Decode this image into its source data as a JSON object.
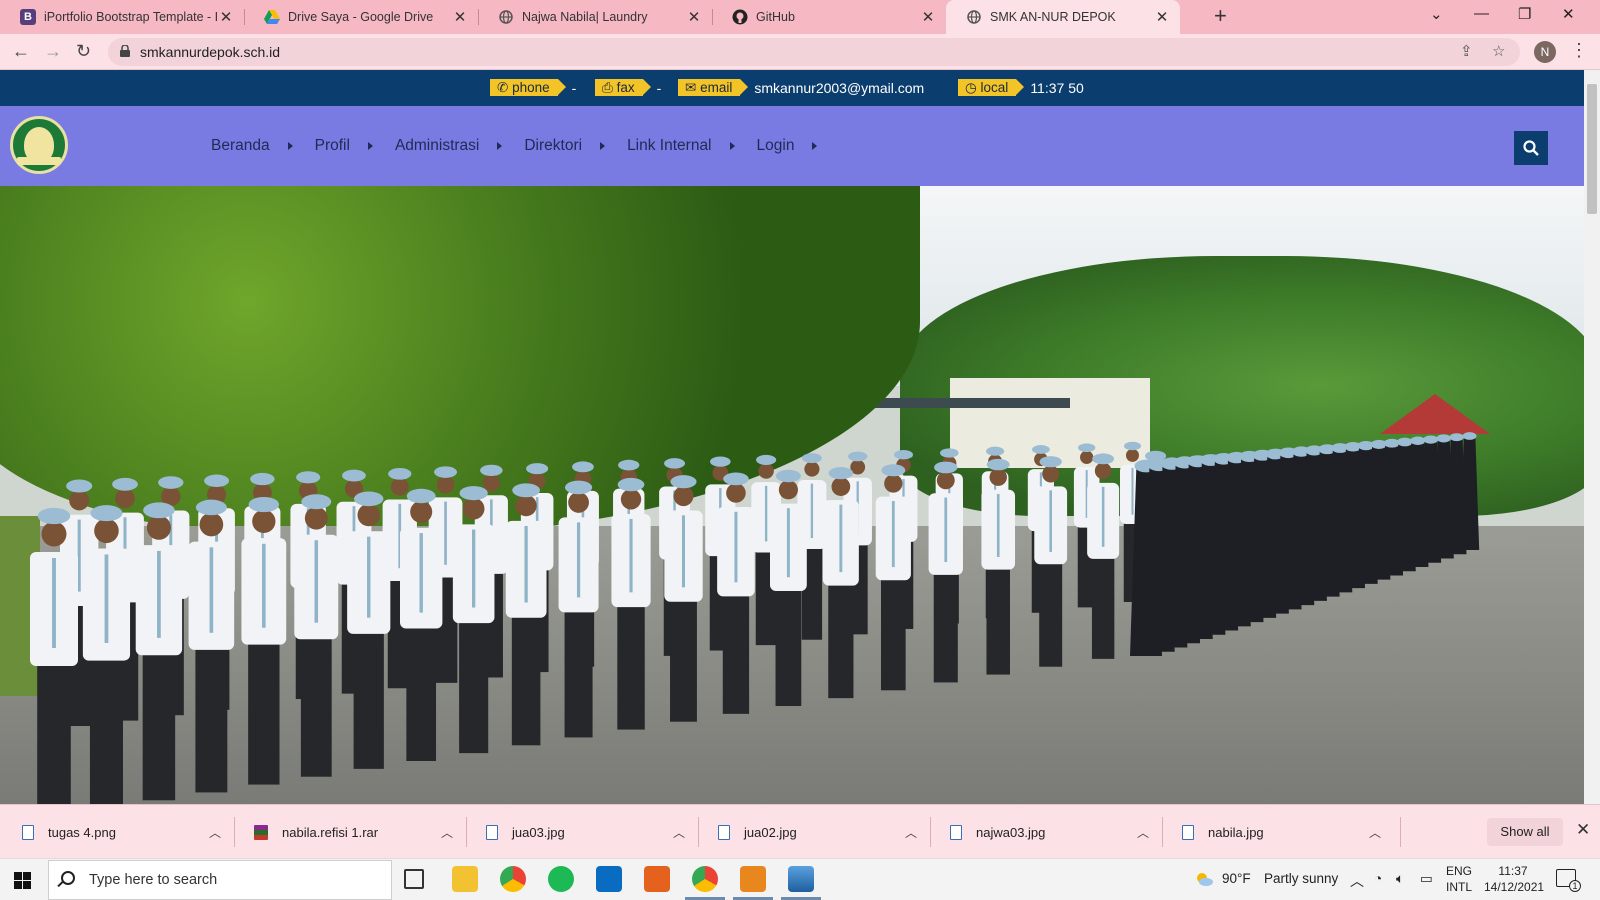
{
  "browser": {
    "tabs": [
      {
        "title": "iPortfolio Bootstrap Template - In",
        "favicon": "bootstrap-icon",
        "active": false
      },
      {
        "title": "Drive Saya - Google Drive",
        "favicon": "google-drive-icon",
        "active": false
      },
      {
        "title": "Najwa Nabila| Laundry",
        "favicon": "globe-icon",
        "active": false
      },
      {
        "title": "GitHub",
        "favicon": "github-icon",
        "active": false
      },
      {
        "title": "SMK AN-NUR DEPOK",
        "favicon": "globe-icon",
        "active": true
      }
    ],
    "url": "smkannurdepok.sch.id",
    "profile_initial": "N"
  },
  "site": {
    "topbar": {
      "items": [
        {
          "tag": "phone",
          "icon": "phone-icon",
          "value": "-"
        },
        {
          "tag": "fax",
          "icon": "fax-icon",
          "value": "-"
        },
        {
          "tag": "email",
          "icon": "envelope-icon",
          "value": "smkannur2003@ymail.com"
        },
        {
          "tag": "local",
          "icon": "clock-icon",
          "value": "11:37 50"
        }
      ]
    },
    "menu": [
      "Beranda",
      "Profil",
      "Administrasi",
      "Direktori",
      "Link Internal",
      "Login"
    ],
    "colors": {
      "topbar": "#0b3d6e",
      "navbar": "#7a7be2",
      "tag": "#f3c428"
    }
  },
  "downloads": {
    "items": [
      {
        "name": "tugas 4.png",
        "icon": "image-file-icon"
      },
      {
        "name": "nabila.refisi 1.rar",
        "icon": "rar-file-icon"
      },
      {
        "name": "jua03.jpg",
        "icon": "image-file-icon"
      },
      {
        "name": "jua02.jpg",
        "icon": "image-file-icon"
      },
      {
        "name": "najwa03.jpg",
        "icon": "image-file-icon"
      },
      {
        "name": "nabila.jpg",
        "icon": "image-file-icon"
      }
    ],
    "show_all": "Show all"
  },
  "taskbar": {
    "search_placeholder": "Type here to search",
    "weather_temp": "90°F",
    "weather_text": "Partly sunny",
    "lang_1": "ENG",
    "lang_2": "INTL",
    "time": "11:37",
    "date": "14/12/2021",
    "notification_count": "1"
  }
}
